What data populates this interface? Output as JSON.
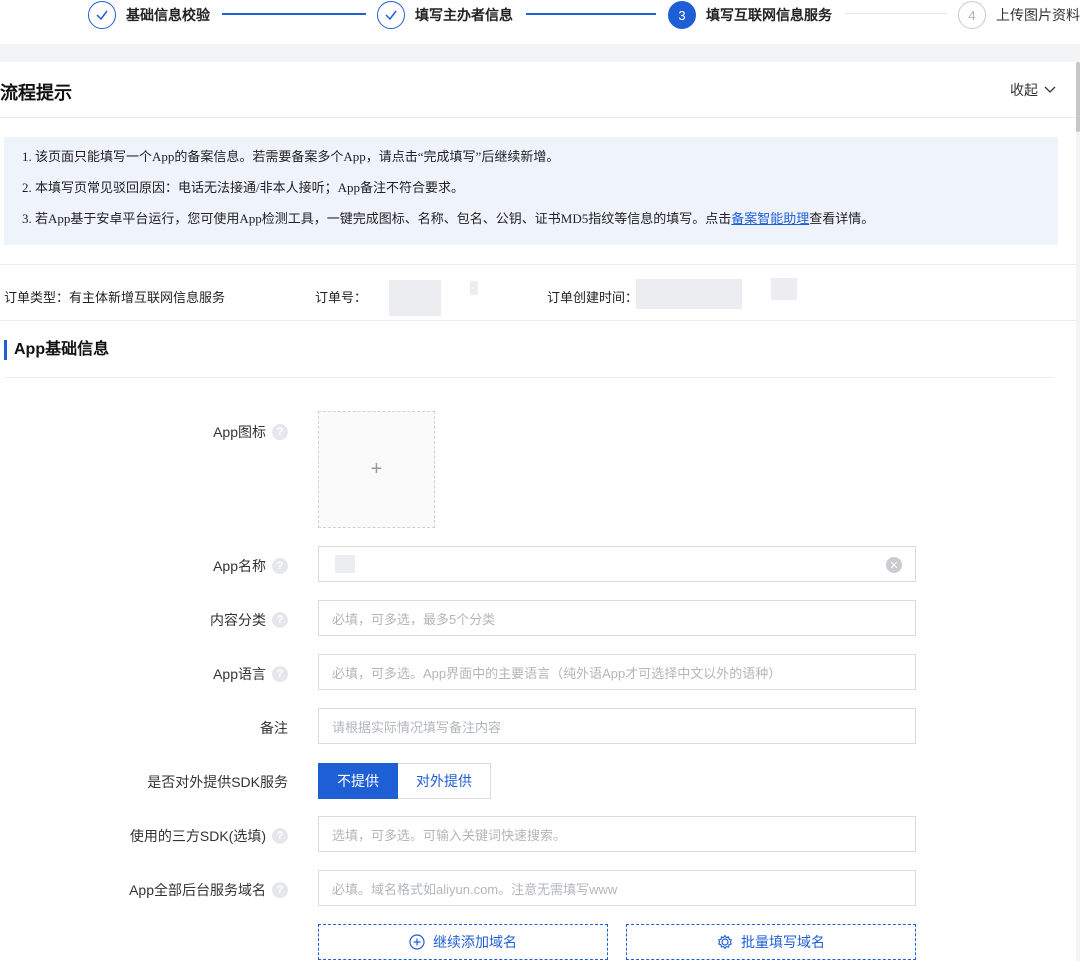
{
  "steps": [
    {
      "label": "基础信息校验",
      "state": "done"
    },
    {
      "label": "填写主办者信息",
      "state": "done"
    },
    {
      "label": "填写互联网信息服务",
      "number": "3",
      "state": "active"
    },
    {
      "label": "上传图片资料",
      "number": "4",
      "state": "todo"
    }
  ],
  "process": {
    "title": "流程提示",
    "collapse_label": "收起",
    "tips": [
      "1. 该页面只能填写一个App的备案信息。若需要备案多个App，请点击“完成填写”后继续新增。",
      "2. 本填写页常见驳回原因：电话无法接通/非本人接听；App备注不符合要求。",
      "3. 若App基于安卓平台运行，您可使用App检测工具，一键完成图标、名称、包名、公钥、证书MD5指纹等信息的填写。点击",
      "备案智能助理",
      "查看详情。"
    ]
  },
  "order": {
    "type_label": "订单类型：",
    "type_value": "有主体新增互联网信息服务",
    "number_label": "订单号：",
    "created_label": "订单创建时间："
  },
  "section": {
    "title": "App基础信息",
    "fields": {
      "icon_label": "App图标",
      "upload_plus": "+",
      "name_label": "App名称",
      "category_label": "内容分类",
      "category_placeholder": "必填，可多选，最多5个分类",
      "language_label": "App语言",
      "language_placeholder": "必填，可多选。App界面中的主要语言（纯外语App才可选择中文以外的语种）",
      "remark_label": "备注",
      "remark_placeholder": "请根据实际情况填写备注内容",
      "sdk_service_label": "是否对外提供SDK服务",
      "sdk_no": "不提供",
      "sdk_yes": "对外提供",
      "third_sdk_label": "使用的三方SDK(选填)",
      "third_sdk_placeholder": "选填，可多选。可输入关键词快速搜索。",
      "domain_label": "App全部后台服务域名",
      "domain_placeholder": "必填。域名格式如aliyun.com。注意无需填写www",
      "add_domain": "继续添加域名",
      "batch_domain": "批量填写域名"
    }
  },
  "colors": {
    "accent": "#1f5fd6",
    "tip_bg": "#eef3fc"
  }
}
